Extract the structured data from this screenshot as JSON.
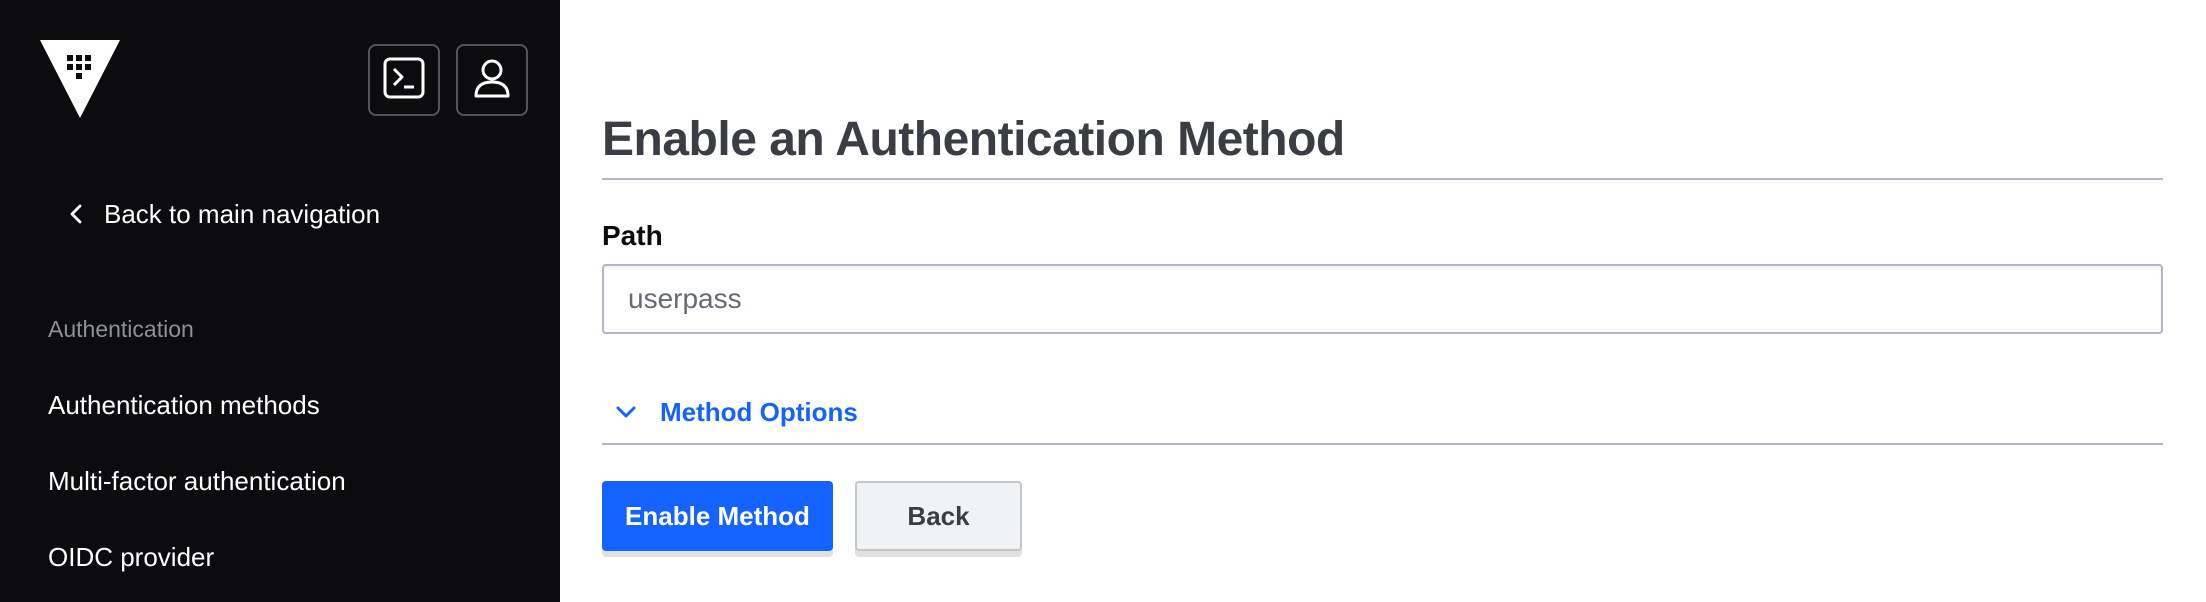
{
  "sidebar": {
    "back_link": "Back to main navigation",
    "section_label": "Authentication",
    "items": [
      {
        "label": "Authentication methods"
      },
      {
        "label": "Multi-factor authentication"
      },
      {
        "label": "OIDC provider"
      }
    ],
    "icons": {
      "logo": "vault-logo-icon",
      "console": "terminal-icon",
      "user": "user-icon"
    }
  },
  "main": {
    "title": "Enable an Authentication Method",
    "path_label": "Path",
    "path_value": "userpass",
    "method_options": "Method Options",
    "enable_button": "Enable Method",
    "back_button": "Back"
  },
  "colors": {
    "sidebar_bg": "#0c0c0e",
    "accent": "#1563ff",
    "title": "#3b3d45",
    "muted": "#8c909c"
  }
}
